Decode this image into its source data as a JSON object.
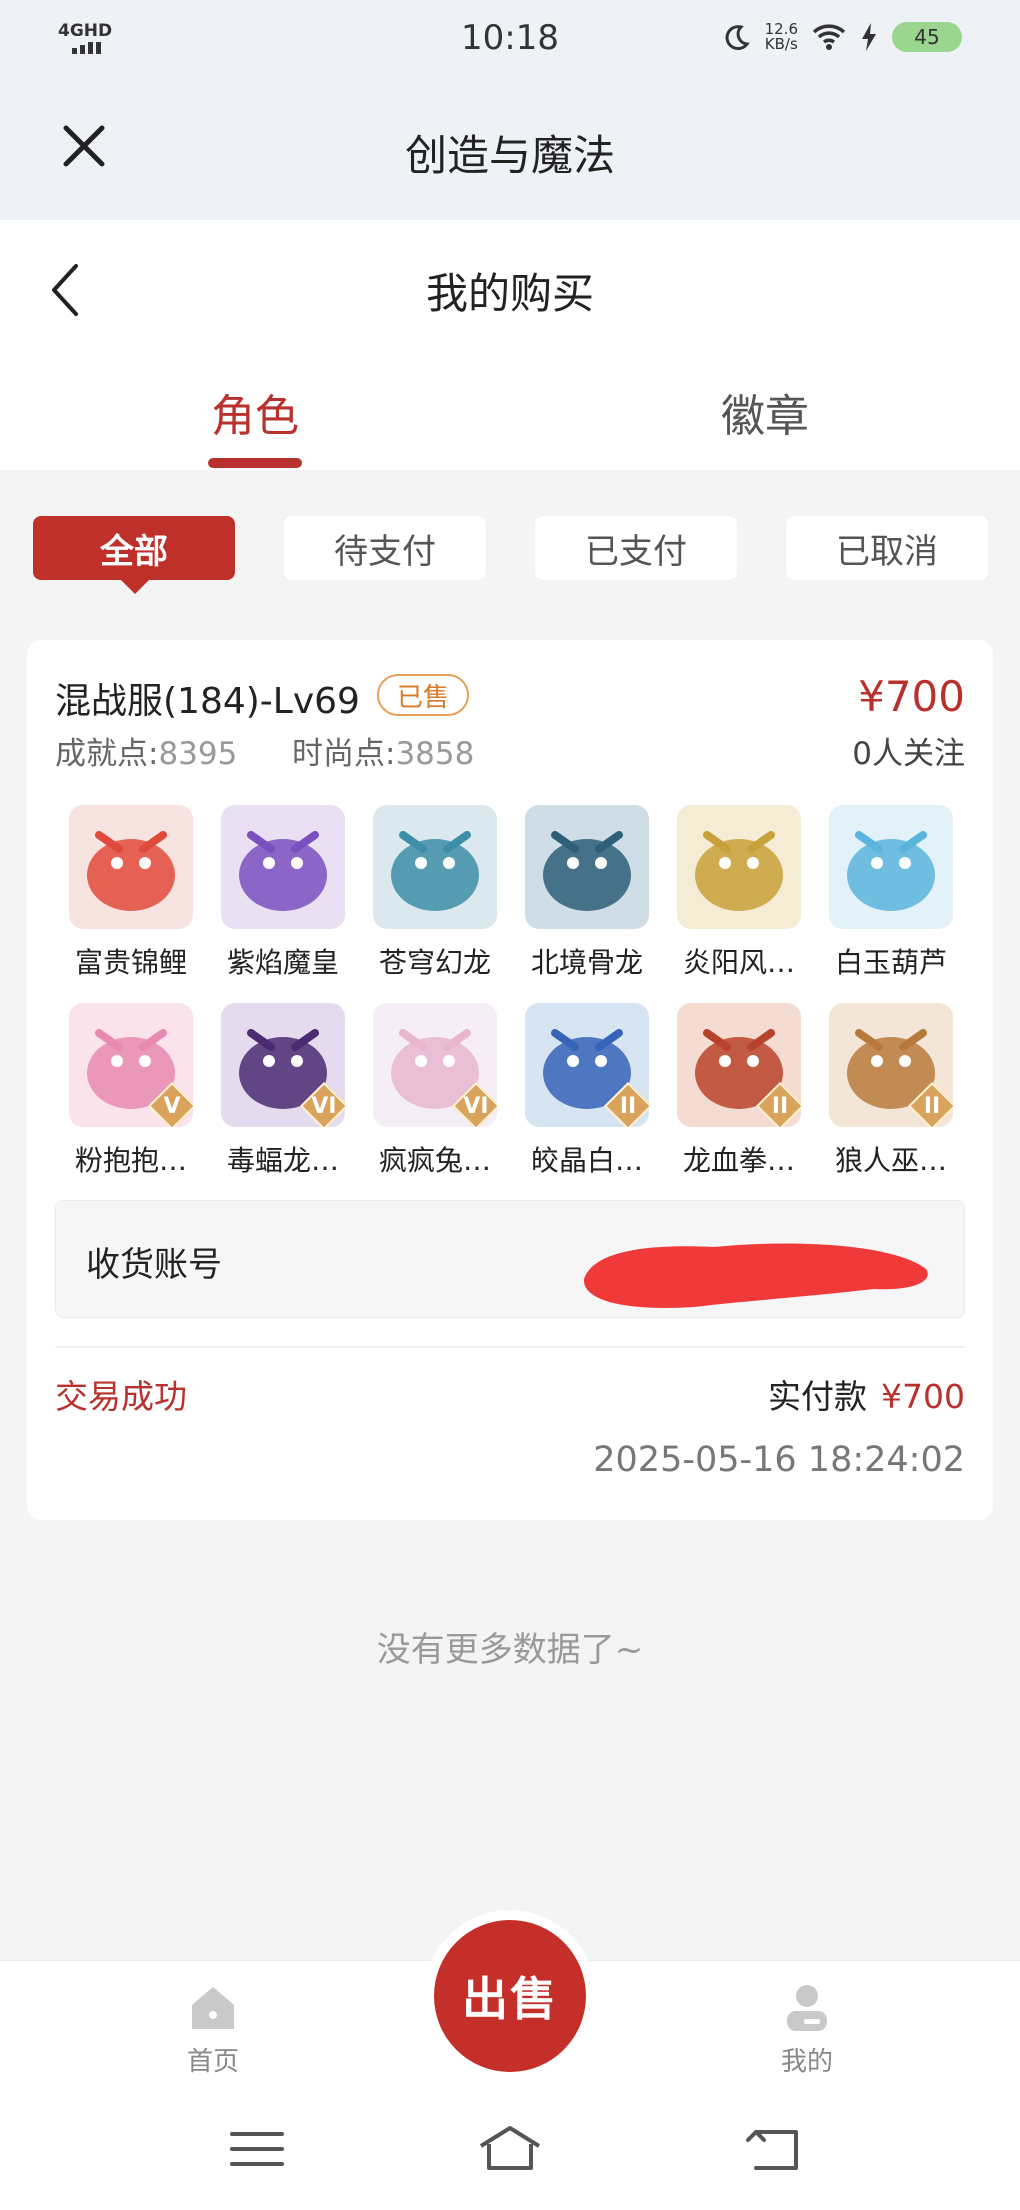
{
  "status_bar": {
    "network": "4GHD",
    "time": "10:18",
    "speed_value": "12.6",
    "speed_unit": "KB/s",
    "battery": "45"
  },
  "app": {
    "title": "创造与魔法"
  },
  "page": {
    "title": "我的购买"
  },
  "tabs": [
    {
      "label": "角色",
      "active": true
    },
    {
      "label": "徽章",
      "active": false
    }
  ],
  "filters": [
    {
      "label": "全部",
      "active": true
    },
    {
      "label": "待支付",
      "active": false
    },
    {
      "label": "已支付",
      "active": false
    },
    {
      "label": "已取消",
      "active": false
    }
  ],
  "order": {
    "server": "混战服(184)-Lv69",
    "badge": "已售",
    "price": "¥700",
    "achievement_label": "成就点:",
    "achievement_value": "8395",
    "fashion_label": "时尚点:",
    "fashion_value": "3858",
    "followers": "0人关注",
    "pets": [
      {
        "name": "富贵锦鲤",
        "bg": "#f7e3e0",
        "color": "#e04a3a",
        "grade": ""
      },
      {
        "name": "紫焰魔皇",
        "bg": "#e9e1f3",
        "color": "#7a4fc0",
        "grade": ""
      },
      {
        "name": "苍穹幻龙",
        "bg": "#dbe9ef",
        "color": "#3d8ea8",
        "grade": ""
      },
      {
        "name": "北境骨龙",
        "bg": "#cfdde6",
        "color": "#2e5f78",
        "grade": ""
      },
      {
        "name": "炎阳风…",
        "bg": "#f5ecd6",
        "color": "#c9a13a",
        "grade": ""
      },
      {
        "name": "白玉葫芦",
        "bg": "#e3f1f8",
        "color": "#5ab4dc",
        "grade": ""
      },
      {
        "name": "粉抱抱…",
        "bg": "#fbe3ec",
        "color": "#e889b0",
        "grade": "V"
      },
      {
        "name": "毒蝠龙…",
        "bg": "#e4dbee",
        "color": "#4b2a72",
        "grade": "VI"
      },
      {
        "name": "疯疯兔…",
        "bg": "#f6eef6",
        "color": "#e8b6d0",
        "grade": "VI"
      },
      {
        "name": "皎晶白…",
        "bg": "#d7e4f2",
        "color": "#3764b8",
        "grade": "II"
      },
      {
        "name": "龙血拳…",
        "bg": "#f4dcd2",
        "color": "#b8432c",
        "grade": "II"
      },
      {
        "name": "狼人巫…",
        "bg": "#f3e6d6",
        "color": "#b77a3c",
        "grade": "II"
      }
    ],
    "account_label": "收货账号",
    "status": "交易成功",
    "paid_label": "实付款",
    "paid_amount": "¥700",
    "time": "2025-05-16 18:24:02"
  },
  "no_more": "没有更多数据了~",
  "tabbar": {
    "home": "首页",
    "sell": "出售",
    "mine": "我的"
  },
  "colors": {
    "accent": "#b9312d",
    "badge": "#d9792a",
    "redaction": "#f03a3a"
  }
}
